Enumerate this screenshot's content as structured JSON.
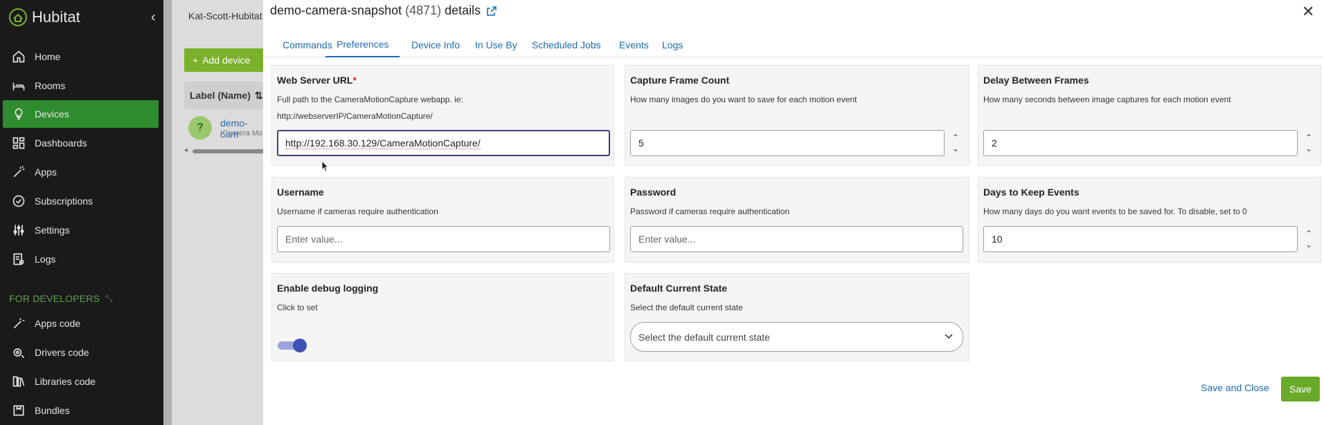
{
  "sidebar": {
    "brand": "Hubitat",
    "items": [
      {
        "label": "Home",
        "icon": "home-icon"
      },
      {
        "label": "Rooms",
        "icon": "bed-icon"
      },
      {
        "label": "Devices",
        "icon": "lightbulb-icon"
      },
      {
        "label": "Dashboards",
        "icon": "grid-icon"
      },
      {
        "label": "Apps",
        "icon": "wand-icon"
      },
      {
        "label": "Subscriptions",
        "icon": "check-circle-icon"
      },
      {
        "label": "Settings",
        "icon": "sliders-icon"
      },
      {
        "label": "Logs",
        "icon": "log-icon"
      }
    ],
    "dev_header": "FOR DEVELOPERS",
    "dev_items": [
      {
        "label": "Apps code",
        "icon": "wand-code-icon"
      },
      {
        "label": "Drivers code",
        "icon": "gear-code-icon"
      },
      {
        "label": "Libraries code",
        "icon": "library-icon"
      },
      {
        "label": "Bundles",
        "icon": "bundle-icon"
      }
    ]
  },
  "background": {
    "hub_name": "Kat-Scott-Hubitat",
    "add_device": "Add device",
    "label_header": "Label (Name)",
    "row_link": "demo-cam",
    "row_sub": "(Camera Mo"
  },
  "dialog": {
    "title": "demo-camera-snapshot",
    "device_id": "(4871)",
    "title_suffix": "details",
    "tabs": [
      "Commands",
      "Preferences",
      "Device Info",
      "In Use By",
      "Scheduled Jobs",
      "Events",
      "Logs"
    ],
    "active_tab": "Preferences",
    "prefs": {
      "web_url": {
        "title": "Web Server URL",
        "required": "*",
        "desc": "Full path to the CameraMotionCapture webapp. ie:",
        "desc2": "http://webserverIP/CameraMotionCapture/",
        "value": "http://192.168.30.129/CameraMotionCapture/"
      },
      "frame_count": {
        "title": "Capture Frame Count",
        "desc": "How many images do you want to save for each motion event",
        "value": "5"
      },
      "delay": {
        "title": "Delay Between Frames",
        "desc": "How many seconds between image captures for each motion event",
        "value": "2"
      },
      "username": {
        "title": "Username",
        "desc": "Username if cameras require authentication",
        "placeholder": "Enter value..."
      },
      "password": {
        "title": "Password",
        "desc": "Password if cameras require authentication",
        "placeholder": "Enter value..."
      },
      "days": {
        "title": "Days to Keep Events",
        "desc": "How many days do you want events to be saved for. To disable, set to 0",
        "value": "10"
      },
      "debug": {
        "title": "Enable debug logging",
        "desc": "Click to set",
        "enabled": true
      },
      "default_state": {
        "title": "Default Current State",
        "desc": "Select the default current state",
        "placeholder": "Select the default current state"
      }
    },
    "save_close": "Save and Close",
    "save": "Save"
  },
  "colors": {
    "sidebar_bg": "#1a1a1a",
    "active_nav": "#2e8b2e",
    "link": "#1a6bb5",
    "save": "#6aaa2a",
    "toggle": "#3f51b5",
    "required": "#d9232e"
  }
}
